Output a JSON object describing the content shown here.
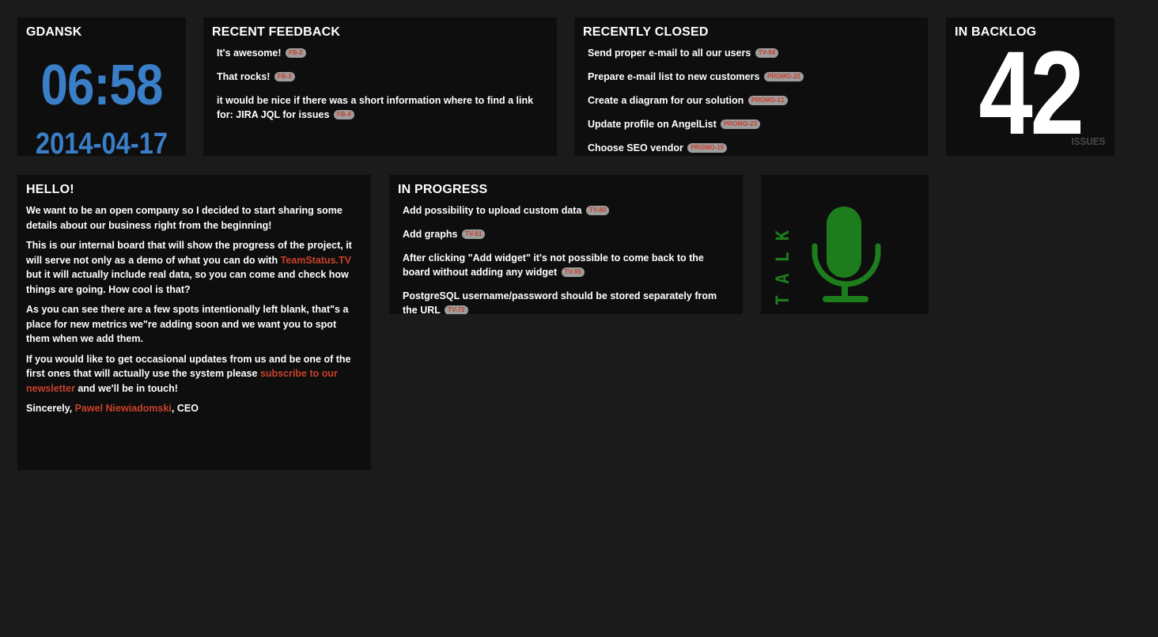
{
  "clock": {
    "city": "GDANSK",
    "time": "06:58",
    "date": "2014-04-17"
  },
  "feedback": {
    "title": "RECENT FEEDBACK",
    "items": [
      {
        "text": "It's awesome!",
        "tag": "FB-2"
      },
      {
        "text": "That rocks!",
        "tag": "FB-3"
      },
      {
        "text": "it would be nice if there was a short information where to find a link for: JIRA JQL for issues",
        "tag": "FB-4"
      }
    ]
  },
  "closed": {
    "title": "RECENTLY CLOSED",
    "items": [
      {
        "text": "Send proper e-mail to all our users",
        "tag": "TV-94"
      },
      {
        "text": "Prepare e-mail list to new customers",
        "tag": "PROMO-22"
      },
      {
        "text": "Create a diagram for our solution",
        "tag": "PROMO-21"
      },
      {
        "text": "Update profile on AngelList",
        "tag": "PROMO-23"
      },
      {
        "text": "Choose SEO vendor",
        "tag": "PROMO-19"
      }
    ]
  },
  "backlog": {
    "title": "IN BACKLOG",
    "count": "42",
    "unit": "ISSUES"
  },
  "hello": {
    "title": "HELLO!",
    "p1": "We want to be an open company so I decided to start sharing some details about our business right from the beginning!",
    "p2_a": "This is our internal board that will show the progress of the project, it will serve not only as a demo of what you can do with ",
    "p2_link": "TeamStatus.TV",
    "p2_b": " but it will actually include real data, so you can come and check how things are going. How cool is that?",
    "p3": "As you can see there are a few spots intentionally left blank, that\"s a place for new metrics we\"re adding soon and we want you to spot them when we add them.",
    "p4_a": "If you would like to get occasional updates from us and be one of the first ones that will actually use the system please ",
    "p4_link": "subscribe to our newsletter",
    "p4_b": " and we'll be in touch!",
    "p5_a": "Sincerely, ",
    "p5_link": "Pawel Niewiadomski",
    "p5_b": ", CEO"
  },
  "progress": {
    "title": "IN PROGRESS",
    "items": [
      {
        "text": "Add possibility to upload custom data",
        "tag": "TV-80"
      },
      {
        "text": "Add graphs",
        "tag": "TV-81"
      },
      {
        "text": "After clicking \"Add widget\" it's not possible to come back to the board without adding any widget",
        "tag": "TV-55"
      },
      {
        "text": "PostgreSQL username/password should be stored separately from the URL",
        "tag": "TV-72"
      }
    ]
  },
  "talk": {
    "label": "TALK",
    "icon": "microphone-icon",
    "color": "#1d7d1d"
  },
  "colors": {
    "accent_blue": "#3b7ec8",
    "link_red": "#c9402c",
    "tag_bg": "#9d9d9d",
    "page_bg": "#1b1b1b",
    "widget_bg": "#0e0e0e"
  }
}
